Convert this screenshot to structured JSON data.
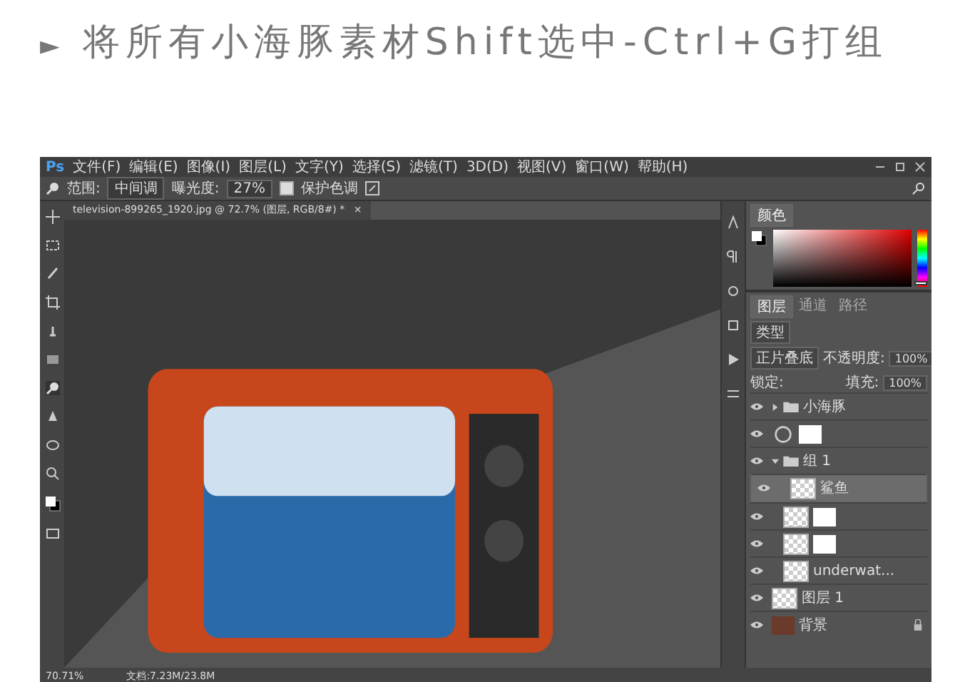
{
  "heading": {
    "marker": "►",
    "text": "将所有小海豚素材Shift选中-Ctrl+G打组"
  },
  "app": {
    "logo": "Ps",
    "menu": [
      "文件(F)",
      "编辑(E)",
      "图像(I)",
      "图层(L)",
      "文字(Y)",
      "选择(S)",
      "滤镜(T)",
      "3D(D)",
      "视图(V)",
      "窗口(W)",
      "帮助(H)"
    ],
    "options": {
      "range_label": "范围:",
      "range_value": "中间调",
      "exposure_label": "曝光度:",
      "exposure_value": "27%",
      "protect_tone": {
        "label": "保护色调",
        "checked": true
      }
    },
    "document_tab": {
      "title": "television-899265_1920.jpg @ 72.7% (图层, RGB/8#) *",
      "close": "×"
    },
    "color_panel": {
      "tab": "颜色",
      "hue": {
        "level": 0.03
      }
    },
    "layers_panel": {
      "tabs": [
        {
          "label": "图层",
          "selected": true
        },
        {
          "label": "通道",
          "selected": false
        },
        {
          "label": "路径",
          "selected": false
        }
      ],
      "filter": "类型",
      "blend_mode": "正片叠底",
      "opacity_label": "不透明度:",
      "opacity": "100%",
      "lock_label": "锁定:",
      "fill_label": "填充:",
      "fill": "100%",
      "layers": [
        {
          "kind": "group",
          "name": "小海豚",
          "visible": true,
          "selected": false,
          "expanded": false
        },
        {
          "kind": "adjustment",
          "visible": true,
          "selected": false
        },
        {
          "kind": "group",
          "name": "组 1",
          "visible": true,
          "selected": false,
          "expanded": true,
          "children": [
            {
              "kind": "layer",
              "name": "鲨鱼",
              "visible": true,
              "selected": true
            },
            {
              "kind": "masked",
              "visible": true,
              "selected": false
            },
            {
              "kind": "masked",
              "visible": true,
              "selected": false
            },
            {
              "kind": "layer",
              "name": "underwat...",
              "visible": true,
              "selected": false
            }
          ]
        },
        {
          "kind": "layer",
          "name": "图层 1",
          "visible": true,
          "selected": false
        },
        {
          "kind": "background",
          "name": "背景",
          "visible": true,
          "selected": false
        }
      ]
    },
    "status": {
      "zoom": "70.71%",
      "document": "文档:7.23M/23.8M"
    }
  }
}
